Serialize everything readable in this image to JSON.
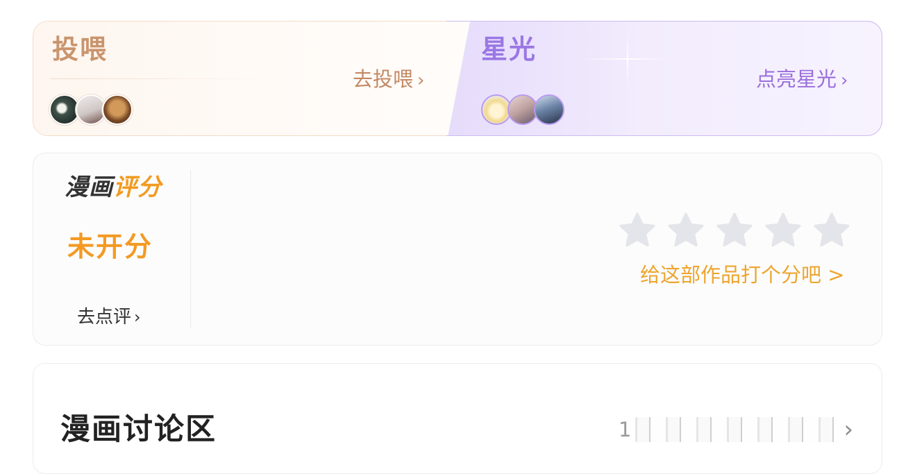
{
  "feed": {
    "title": "投喂",
    "link_label": "去投喂",
    "chevron": "›",
    "avatars": [
      "avatar-1",
      "avatar-2",
      "avatar-3"
    ],
    "accent_color": "#c9956e"
  },
  "starlight": {
    "title": "星光",
    "link_label": "点亮星光",
    "chevron": "›",
    "avatars": [
      "avatar-1",
      "avatar-2",
      "avatar-3"
    ],
    "accent_color": "#9a77e4"
  },
  "rating": {
    "logo_part1": "漫画",
    "logo_part2": "评分",
    "status": "未开分",
    "review_link": "去点评",
    "review_chevron": "›",
    "star_count": 5,
    "stars_filled": 0,
    "star_icon": "star-icon",
    "prompt": "给这部作品打个分吧 >",
    "accent_color": "#f39a24",
    "star_color": "#e4e5ea"
  },
  "discussion": {
    "title": "漫画讨论区",
    "meta_visible_prefix": "1",
    "chevron": "›"
  }
}
